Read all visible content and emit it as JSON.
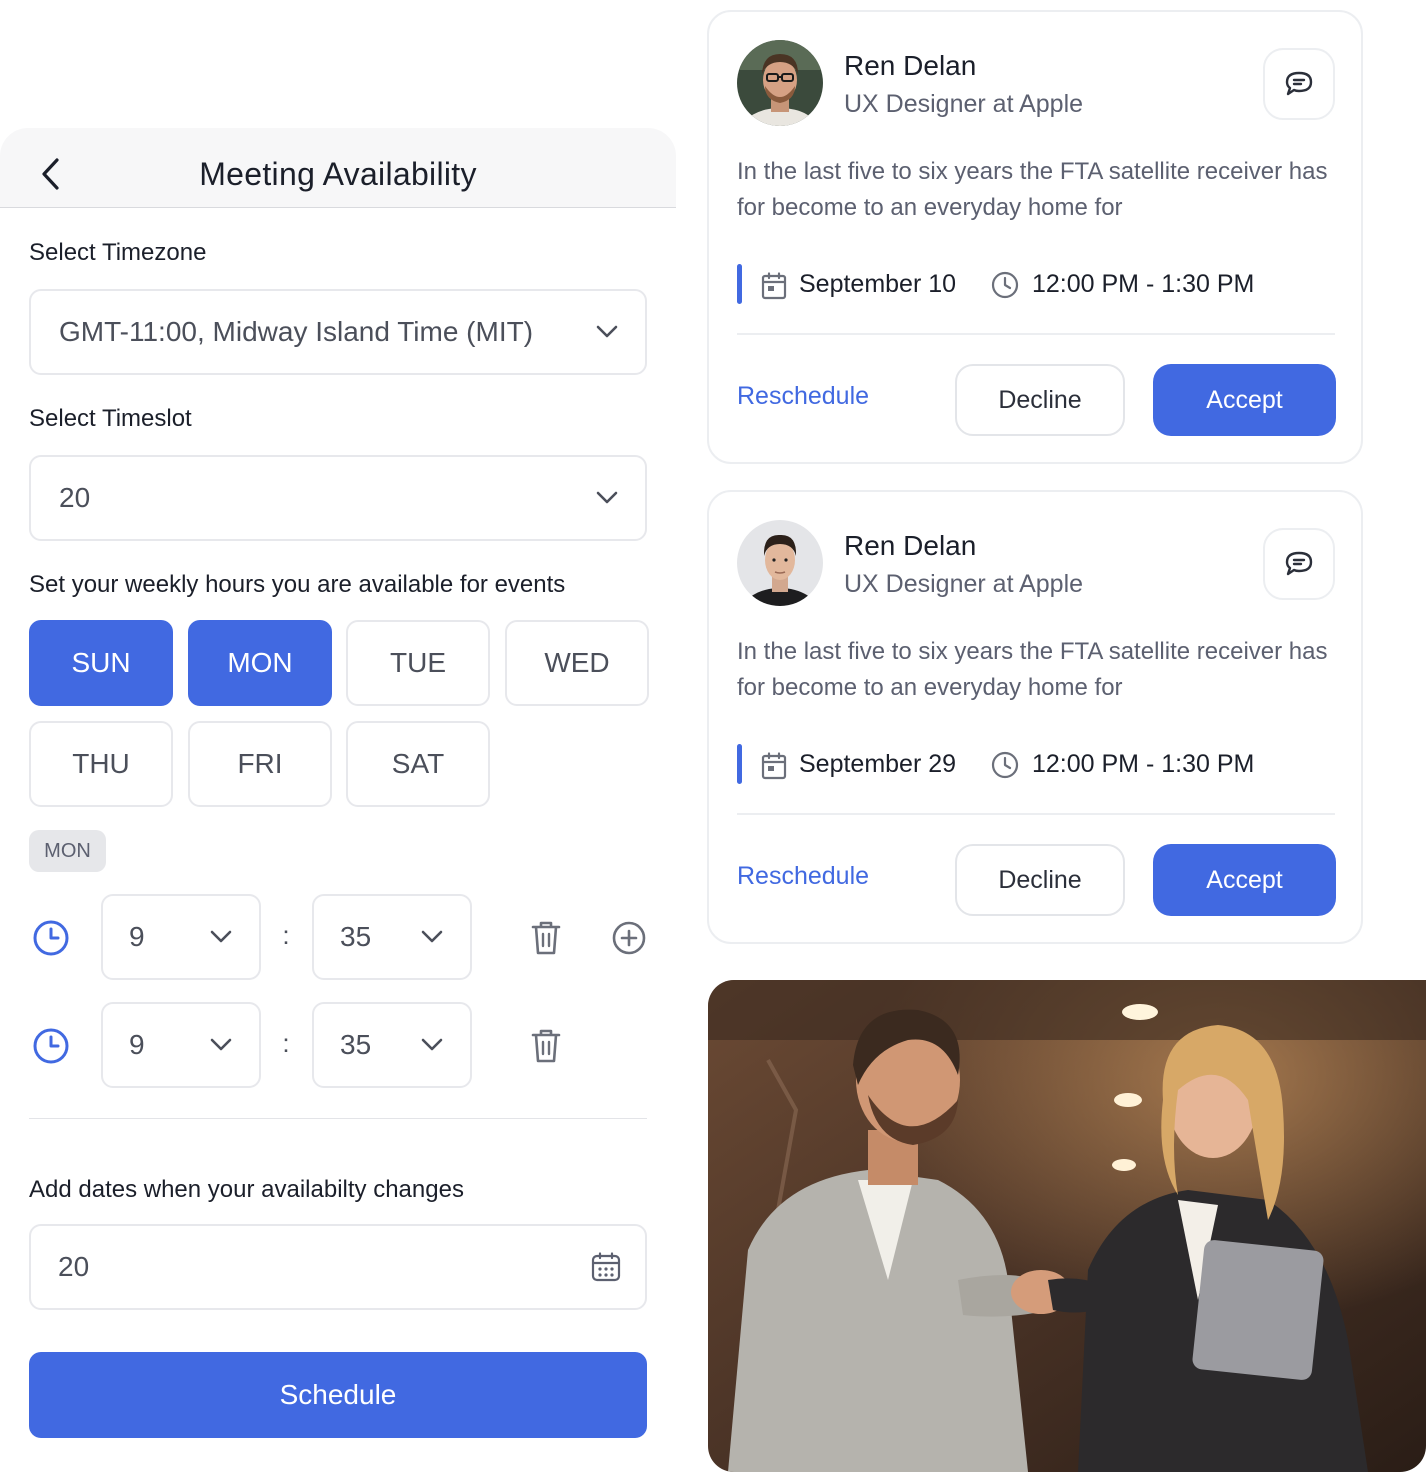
{
  "availability": {
    "title": "Meeting Availability",
    "timezone_label": "Select Timezone",
    "timezone_value": "GMT-11:00, Midway Island Time (MIT)",
    "timeslot_label": "Select Timeslot",
    "timeslot_value": "20",
    "weekly_label": "Set your weekly hours you are available for events",
    "days": [
      {
        "label": "SUN",
        "active": true
      },
      {
        "label": "MON",
        "active": true
      },
      {
        "label": "TUE",
        "active": false
      },
      {
        "label": "WED",
        "active": false
      },
      {
        "label": "THU",
        "active": false
      },
      {
        "label": "FRI",
        "active": false
      },
      {
        "label": "SAT",
        "active": false
      }
    ],
    "selected_day_badge": "MON",
    "time_rows": [
      {
        "hour": "9",
        "separator": ":",
        "minute": "35"
      },
      {
        "hour": "9",
        "separator": ":",
        "minute": "35"
      }
    ],
    "date_changes_label": "Add dates when your availabilty changes",
    "date_changes_value": "20",
    "schedule_label": "Schedule"
  },
  "requests": [
    {
      "name": "Ren Delan",
      "role": "UX Designer at Apple",
      "description": "In the last five to six years the FTA satellite receiver has for become to an everyday home for",
      "date": "September 10",
      "time": "12:00 PM - 1:30 PM",
      "reschedule_label": "Reschedule",
      "decline_label": "Decline",
      "accept_label": "Accept"
    },
    {
      "name": "Ren Delan",
      "role": "UX Designer at Apple",
      "description": "In the last five to six years the FTA satellite receiver has for become to an everyday home for",
      "date": "September 29",
      "time": "12:00 PM - 1:30 PM",
      "reschedule_label": "Reschedule",
      "decline_label": "Decline",
      "accept_label": "Accept"
    }
  ],
  "colors": {
    "accent": "#4169e1",
    "border": "#e7e8ec",
    "text": "#1b1f2a",
    "muted_text": "#5c6070"
  },
  "icons": [
    "chevron-left-icon",
    "chevron-down-icon",
    "clock-icon",
    "trash-icon",
    "add-circle-icon",
    "calendar-icon",
    "chat-icon"
  ]
}
